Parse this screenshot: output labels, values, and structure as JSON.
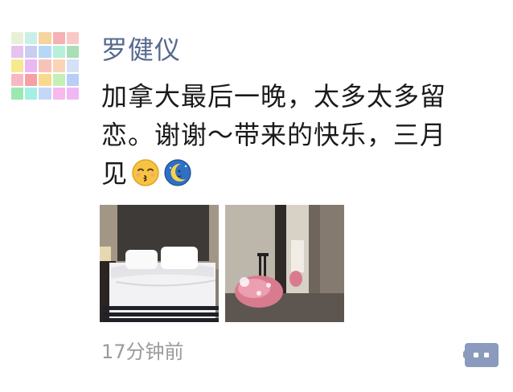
{
  "post": {
    "author": "罗健仪",
    "text_lines": [
      "加拿大最后一晚，太多太多留",
      "恋。谢谢～带来的快乐，三月",
      "见"
    ],
    "emojis": [
      "kissing-face-closed-eyes",
      "crescent-moon-face"
    ],
    "photos": [
      {
        "name": "hotel-bed-photo",
        "icon": "bed"
      },
      {
        "name": "luggage-doorway-photo",
        "icon": "suitcase"
      }
    ],
    "timestamp": "17分钟前",
    "comment_icon": "comment-icon",
    "colors": {
      "author_name": "#56698e",
      "timestamp": "#9a9a9a",
      "comment_button": "#8a9bbd"
    }
  },
  "avatar": {
    "icon": "identicon-avatar",
    "palette": [
      "#e8f0d8",
      "#c9f0e8",
      "#f6d4a0",
      "#f7b0b4",
      "#f9c9c6",
      "#e7c2f0",
      "#c9cdf2",
      "#b6d8f7",
      "#b6f0d9",
      "#a9dfb5",
      "#f9e98e",
      "#e9b8f4",
      "#f7c3b8",
      "#f9d4b8",
      "#d5e0f9",
      "#f7b8c4",
      "#f4a0a4",
      "#f9d98e",
      "#c4f0b6",
      "#b8cef7",
      "#9be8b0",
      "#a3efe3",
      "#c7d6f7",
      "#f7b8ec",
      "#f0b8f4"
    ]
  }
}
